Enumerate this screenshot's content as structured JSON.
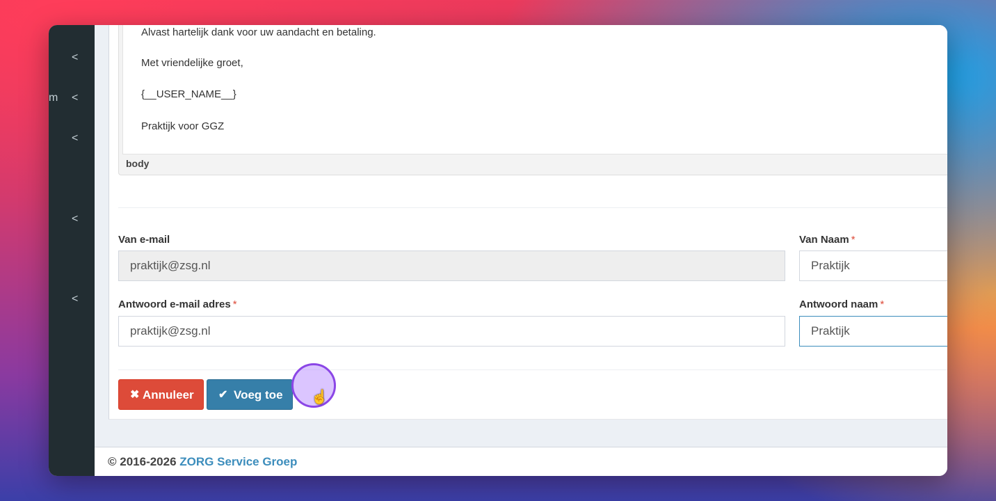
{
  "sidebar": {
    "items": [
      {
        "icon": "chevron-left-icon",
        "glyph": "<"
      },
      {
        "icon": "chevron-left-icon",
        "glyph": "<",
        "fragment": "m"
      },
      {
        "icon": "chevron-left-icon",
        "glyph": "<"
      },
      {
        "icon": "chevron-left-icon",
        "glyph": "<"
      },
      {
        "icon": "chevron-left-icon",
        "glyph": "<"
      }
    ]
  },
  "editor": {
    "lines": [
      "Alvast hartelijk dank voor uw aandacht en betaling.",
      "Met vriendelijke groet,",
      "{__USER_NAME__}",
      "Praktijk voor GGZ"
    ],
    "status_path": "body"
  },
  "form": {
    "from_email": {
      "label": "Van e-mail",
      "value": "praktijk@zsg.nl"
    },
    "from_name": {
      "label": "Van Naam",
      "required_mark": "*",
      "value": "Praktijk"
    },
    "reply_email": {
      "label": "Antwoord e-mail adres",
      "required_mark": "*",
      "value": "praktijk@zsg.nl"
    },
    "reply_name": {
      "label": "Antwoord naam",
      "required_mark": "*",
      "value": "Praktijk"
    }
  },
  "buttons": {
    "cancel": {
      "label": "Annuleer",
      "icon": "times-icon",
      "glyph": "✖",
      "color": "#dd4b39"
    },
    "add": {
      "label": "Voeg toe",
      "icon": "check-icon",
      "glyph": "✔",
      "color": "#367fa9"
    }
  },
  "cursor": {
    "icon": "hand-pointer-icon",
    "glyph": "☝"
  },
  "footer": {
    "copyright": "© 2016-2026",
    "company": "ZORG Service Groep",
    "link_color": "#3c8dbc"
  }
}
